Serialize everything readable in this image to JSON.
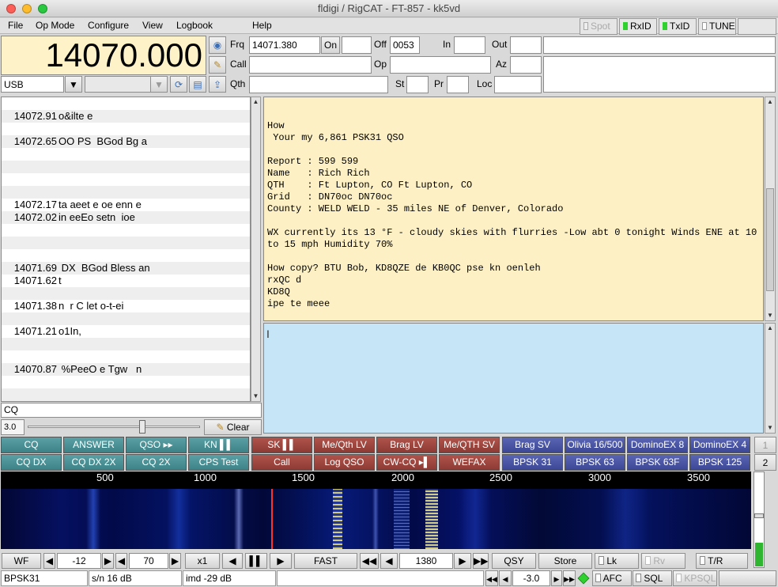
{
  "window": {
    "title": "fldigi / RigCAT - FT-857 - kk5vd"
  },
  "menu": [
    "File",
    "Op Mode",
    "Configure",
    "View",
    "Logbook",
    "Help"
  ],
  "top_right": {
    "spot": "Spot",
    "rxid": "RxID",
    "txid": "TxID",
    "tune": "TUNE"
  },
  "rig": {
    "frequency": "14070.000",
    "mode": "USB",
    "bandwidth": ""
  },
  "log": {
    "frq_label": "Frq",
    "frq": "14071.380",
    "on_label": "On",
    "on": "",
    "off_label": "Off",
    "off": "0053",
    "in_label": "In",
    "in": "",
    "out_label": "Out",
    "out": "",
    "call_label": "Call",
    "call": "",
    "op_label": "Op",
    "op": "",
    "az_label": "Az",
    "az": "",
    "qth_label": "Qth",
    "qth": "",
    "st_label": "St",
    "st": "",
    "pr_label": "Pr",
    "pr": "",
    "loc_label": "Loc",
    "loc": ""
  },
  "viewer": {
    "rows": [
      {
        "freq": "",
        "text": ""
      },
      {
        "freq": "14072.91",
        "text": "o&ilte e"
      },
      {
        "freq": "",
        "text": ""
      },
      {
        "freq": "14072.65",
        "text": "OO PS  BGod Bg a"
      },
      {
        "freq": "",
        "text": ""
      },
      {
        "freq": "",
        "text": ""
      },
      {
        "freq": "",
        "text": ""
      },
      {
        "freq": "",
        "text": ""
      },
      {
        "freq": "14072.17",
        "text": "ta aeet e oe enn e"
      },
      {
        "freq": "14072.02",
        "text": "in eeEo setn  ioe"
      },
      {
        "freq": "",
        "text": ""
      },
      {
        "freq": "",
        "text": ""
      },
      {
        "freq": "",
        "text": ""
      },
      {
        "freq": "14071.69",
        "text": " DX  BGod Bless an"
      },
      {
        "freq": "14071.62",
        "text": "t"
      },
      {
        "freq": "",
        "text": ""
      },
      {
        "freq": "14071.38",
        "text": "n  r C let o-t-ei"
      },
      {
        "freq": "",
        "text": ""
      },
      {
        "freq": "14071.21",
        "text": "o1In,"
      },
      {
        "freq": "",
        "text": ""
      },
      {
        "freq": "",
        "text": ""
      },
      {
        "freq": "14070.87",
        "text": " %PeeO e Tgw   n"
      },
      {
        "freq": "",
        "text": ""
      },
      {
        "freq": "",
        "text": ""
      }
    ],
    "search": "CQ",
    "squelch": "3.0",
    "clear_label": "Clear"
  },
  "rx_text": "How\n Your my 6,861 PSK31 QSO\n\nReport : 599 599\nName   : Rich Rich\nQTH    : Ft Lupton, CO Ft Lupton, CO\nGrid   : DN70oc DN70oc\nCounty : WELD WELD - 35 miles NE of Denver, Colorado\n\nWX currently its 13 °F - cloudy skies with flurries -Low abt 0 tonight Winds ENE at 10\nto 15 mph Humidity 70%\n\nHow copy? BTU Bob, KD8QZE de KB0QC pse kn oenleh\nrxQC d\nKD8Q\nipe te meee",
  "macros_row1": [
    {
      "label": "CQ",
      "c": "teal"
    },
    {
      "label": "ANSWER",
      "c": "teal"
    },
    {
      "label": "QSO ▸▸",
      "c": "teal"
    },
    {
      "label": "KN ▌▌",
      "c": "teal"
    },
    {
      "label": "SK ▌▌",
      "c": "red"
    },
    {
      "label": "Me/Qth LV",
      "c": "red"
    },
    {
      "label": "Brag LV",
      "c": "red"
    },
    {
      "label": "Me/QTH SV",
      "c": "red"
    },
    {
      "label": "Brag SV",
      "c": "blue"
    },
    {
      "label": "Olivia 16/500",
      "c": "blue"
    },
    {
      "label": "DominoEX 8",
      "c": "blue"
    },
    {
      "label": "DominoEX 4",
      "c": "blue"
    }
  ],
  "macros_row2": [
    {
      "label": "CQ DX",
      "c": "teal"
    },
    {
      "label": "CQ DX 2X",
      "c": "teal"
    },
    {
      "label": "CQ 2X",
      "c": "teal"
    },
    {
      "label": "CPS Test",
      "c": "teal"
    },
    {
      "label": "Call",
      "c": "red"
    },
    {
      "label": "Log QSO",
      "c": "red"
    },
    {
      "label": "CW-CQ ▸▌",
      "c": "red"
    },
    {
      "label": "WEFAX",
      "c": "red"
    },
    {
      "label": "BPSK 31",
      "c": "blue"
    },
    {
      "label": "BPSK 63",
      "c": "blue"
    },
    {
      "label": "BPSK 63F",
      "c": "blue"
    },
    {
      "label": "BPSK 125",
      "c": "blue"
    }
  ],
  "macro_sets": [
    "1",
    "2"
  ],
  "scale_ticks": [
    "500",
    "1000",
    "1500",
    "2000",
    "2500",
    "3000",
    "3500"
  ],
  "waterfall_controls": {
    "wf": "WF",
    "ref": "-12",
    "range": "70",
    "zoom": "x1",
    "speed": "FAST",
    "carrier": "1380",
    "qsy": "QSY",
    "store": "Store",
    "lk": "Lk",
    "rv": "Rv",
    "tr": "T/R"
  },
  "status": {
    "mode": "BPSK31",
    "sn": "s/n 16 dB",
    "imd": "imd -29 dB",
    "msg": "",
    "afc_offset": "-3.0",
    "afc": "AFC",
    "sql": "SQL",
    "kpsql": "KPSQL"
  },
  "colors": {
    "rx_bg": "#fdf0c4",
    "tx_bg": "#c6e6f8",
    "teal": "#4a9094",
    "red": "#9e4740",
    "blue": "#4b57a6",
    "led_green": "#2fd12f"
  }
}
